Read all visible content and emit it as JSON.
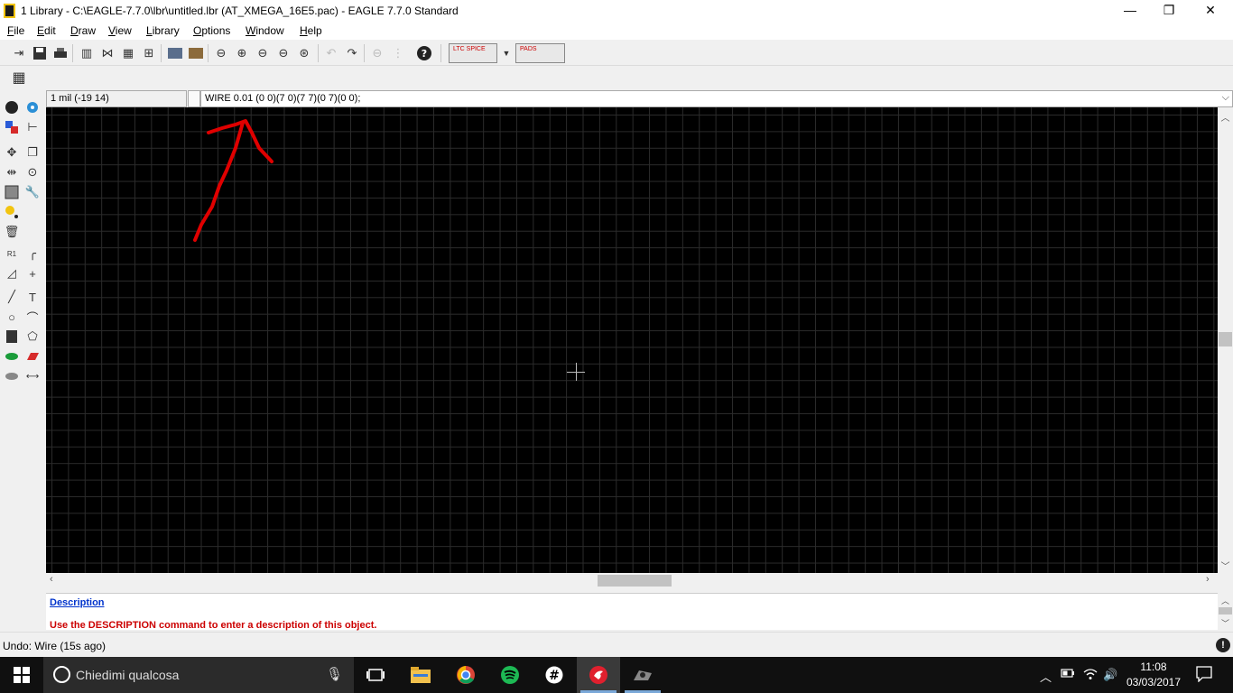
{
  "window": {
    "title": "1 Library - C:\\EAGLE-7.7.0\\lbr\\untitled.lbr (AT_XMEGA_16E5.pac) - EAGLE 7.7.0 Standard",
    "minimize": "—",
    "maximize": "❐",
    "close": "✕"
  },
  "menu": [
    {
      "label": "File",
      "access": "F",
      "rest": "ile"
    },
    {
      "label": "Edit",
      "access": "E",
      "rest": "dit"
    },
    {
      "label": "Draw",
      "access": "D",
      "rest": "raw"
    },
    {
      "label": "View",
      "access": "V",
      "rest": "iew"
    },
    {
      "label": "Library",
      "access": "L",
      "rest": "ibrary"
    },
    {
      "label": "Options",
      "access": "O",
      "rest": "ptions"
    },
    {
      "label": "Window",
      "access": "W",
      "rest": "indow"
    },
    {
      "label": "Help",
      "access": "H",
      "rest": "elp"
    }
  ],
  "toolbar": {
    "ltspice_label": "LTC SPICE",
    "pads_label": "PADS"
  },
  "coordinates": "1 mil (-19 14)",
  "command_line": "WIRE 0.01 (0 0)(7 0)(7 7)(0 7)(0 0);",
  "description": {
    "header": "Description",
    "message": "Use the DESCRIPTION command to enter a description of this object."
  },
  "status": {
    "text": "Undo: Wire (15s ago)",
    "stop_glyph": "!"
  },
  "taskbar": {
    "search_placeholder": "Chiedimi qualcosa",
    "time": "11:08",
    "date": "03/03/2017"
  },
  "colors": {
    "canvas": "#000000",
    "grid": "#2b2b2b",
    "annotation_arrow": "#e00000",
    "description_header": "#0033cc",
    "description_message": "#cc0000"
  }
}
